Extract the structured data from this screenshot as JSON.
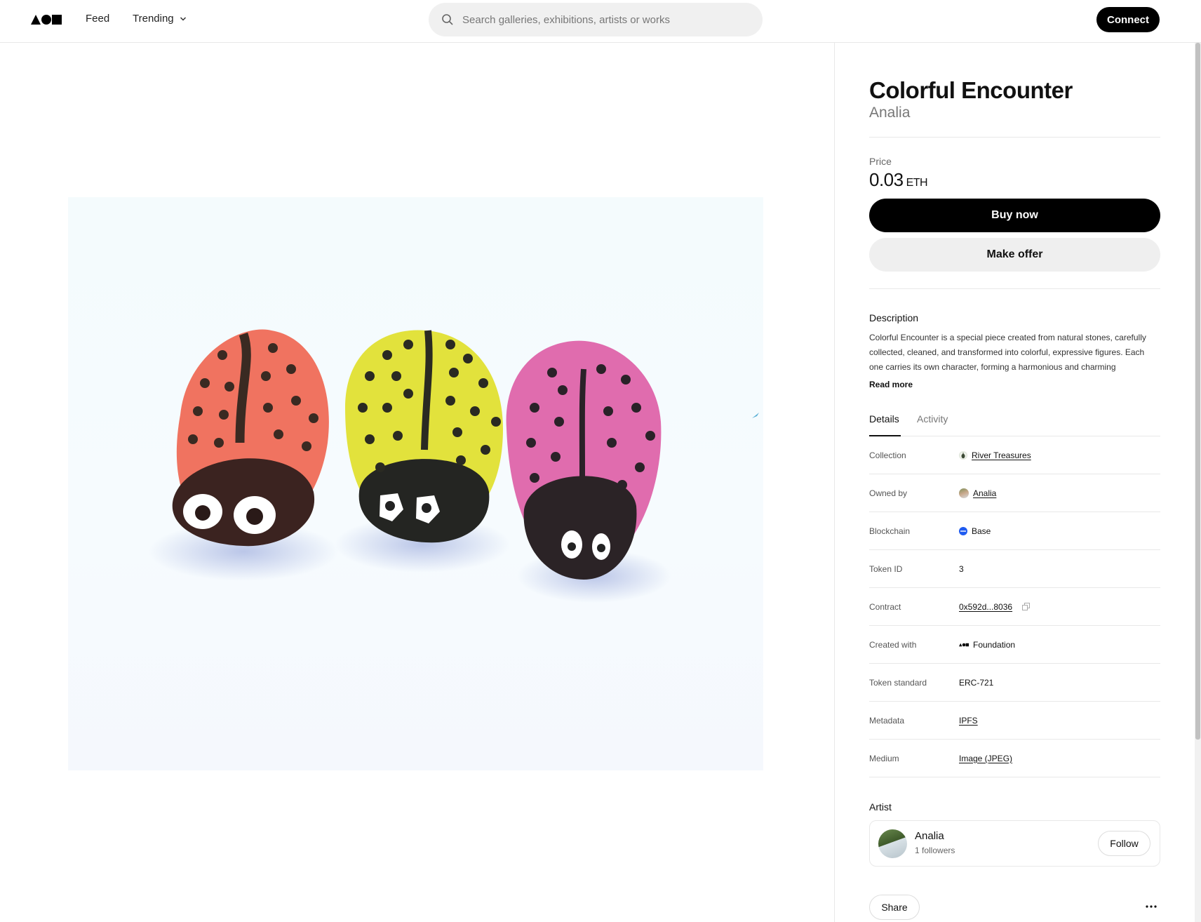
{
  "header": {
    "nav_feed": "Feed",
    "nav_trending": "Trending",
    "search_placeholder": "Search galleries, exhibitions, artists or works",
    "connect_label": "Connect"
  },
  "artwork": {
    "title": "Colorful Encounter",
    "artist": "Analia",
    "image_alt_colors": {
      "background": "#f4fbfd",
      "ladybug_red": "#f07360",
      "ladybug_yellow": "#e2e23c",
      "ladybug_pink": "#e06cae",
      "spots": "#2a2a22"
    }
  },
  "price": {
    "label": "Price",
    "amount": "0.03",
    "unit": "ETH"
  },
  "actions": {
    "buy_label": "Buy now",
    "offer_label": "Make offer"
  },
  "description": {
    "heading": "Description",
    "text": "Colorful Encounter is a special piece created from natural stones, carefully collected, cleaned, and transformed into colorful, expressive figures. Each one carries its own character, forming a harmonious and charming",
    "read_more": "Read more"
  },
  "tabs": [
    {
      "label": "Details",
      "active": true
    },
    {
      "label": "Activity",
      "active": false
    }
  ],
  "details": {
    "collection": {
      "label": "Collection",
      "value": "River Treasures",
      "icon": "collection-thumb-icon"
    },
    "owned_by": {
      "label": "Owned by",
      "value": "Analia",
      "icon": "owner-avatar-icon"
    },
    "blockchain": {
      "label": "Blockchain",
      "value": "Base",
      "icon": "base-chain-icon",
      "icon_color": "#1f5bf0"
    },
    "token_id": {
      "label": "Token ID",
      "value": "3"
    },
    "contract": {
      "label": "Contract",
      "value": "0x592d...8036",
      "icon": "copy-icon"
    },
    "created_with": {
      "label": "Created with",
      "value": "Foundation",
      "icon": "foundation-logo-icon"
    },
    "token_standard": {
      "label": "Token standard",
      "value": "ERC-721"
    },
    "metadata": {
      "label": "Metadata",
      "value": "IPFS"
    },
    "medium": {
      "label": "Medium",
      "value": "Image (JPEG)"
    }
  },
  "artist_section": {
    "heading": "Artist",
    "name": "Analia",
    "followers": "1 followers",
    "follow_label": "Follow"
  },
  "footer_actions": {
    "share_label": "Share",
    "more_icon": "ellipsis-icon"
  }
}
